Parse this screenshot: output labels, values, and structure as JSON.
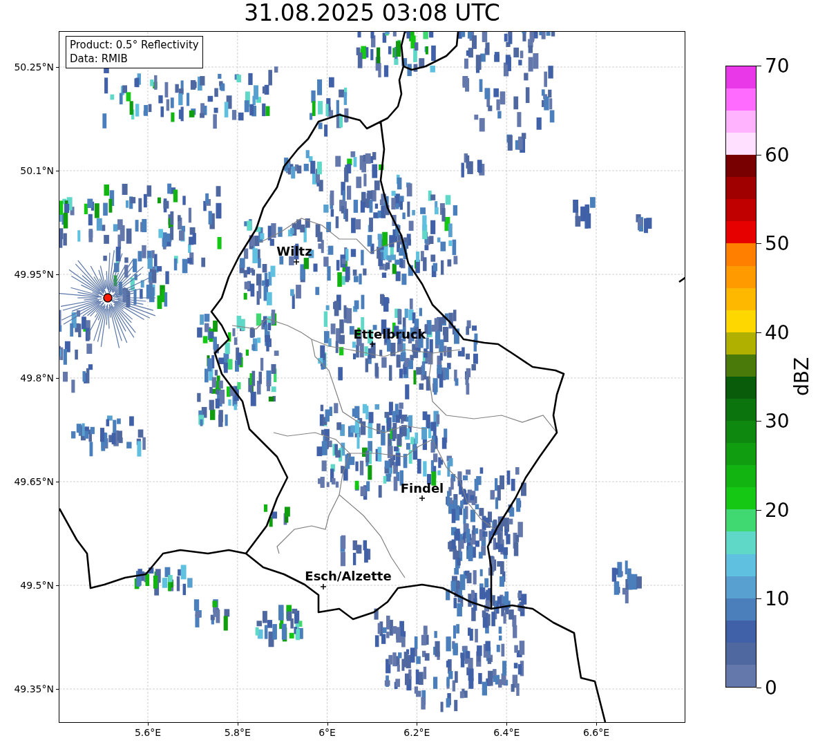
{
  "title": "31.08.2025 03:08 UTC",
  "info_box": [
    "Product: 0.5° Reflectivity",
    "Data: RMIB"
  ],
  "map": {
    "lat_ticks": [
      "50.25°N",
      "50.1°N",
      "49.95°N",
      "49.8°N",
      "49.65°N",
      "49.5°N",
      "49.35°N"
    ],
    "lon_ticks": [
      "5.6°E",
      "5.8°E",
      "6°E",
      "6.2°E",
      "6.4°E",
      "6.6°E"
    ],
    "cities": [
      {
        "name": "Wiltz"
      },
      {
        "name": "Ettelbruck"
      },
      {
        "name": "Findel"
      },
      {
        "name": "Esch/Alzette"
      }
    ]
  },
  "colorbar": {
    "label": "dBZ",
    "ticks": [
      "70",
      "60",
      "50",
      "40",
      "30",
      "20",
      "10",
      "0"
    ],
    "bands": [
      {
        "color": "#6478ac"
      },
      {
        "color": "#5068a0"
      },
      {
        "color": "#4060a8"
      },
      {
        "color": "#4a7fbb"
      },
      {
        "color": "#58a0d0"
      },
      {
        "color": "#60c0e0"
      },
      {
        "color": "#60d8c8"
      },
      {
        "color": "#40d870"
      },
      {
        "color": "#14c814"
      },
      {
        "color": "#12b412"
      },
      {
        "color": "#109e10"
      },
      {
        "color": "#0e880e"
      },
      {
        "color": "#0c740c"
      },
      {
        "color": "#085c0a"
      },
      {
        "color": "#4a7a0a"
      },
      {
        "color": "#b0b000"
      },
      {
        "color": "#ffd700"
      },
      {
        "color": "#ffb800"
      },
      {
        "color": "#ff9a00"
      },
      {
        "color": "#ff7f00"
      },
      {
        "color": "#e60000"
      },
      {
        "color": "#c00000"
      },
      {
        "color": "#a00000"
      },
      {
        "color": "#780000"
      },
      {
        "color": "#ffe0ff"
      },
      {
        "color": "#ffb3ff"
      },
      {
        "color": "#ff6aff"
      },
      {
        "color": "#e838e8"
      }
    ]
  }
}
